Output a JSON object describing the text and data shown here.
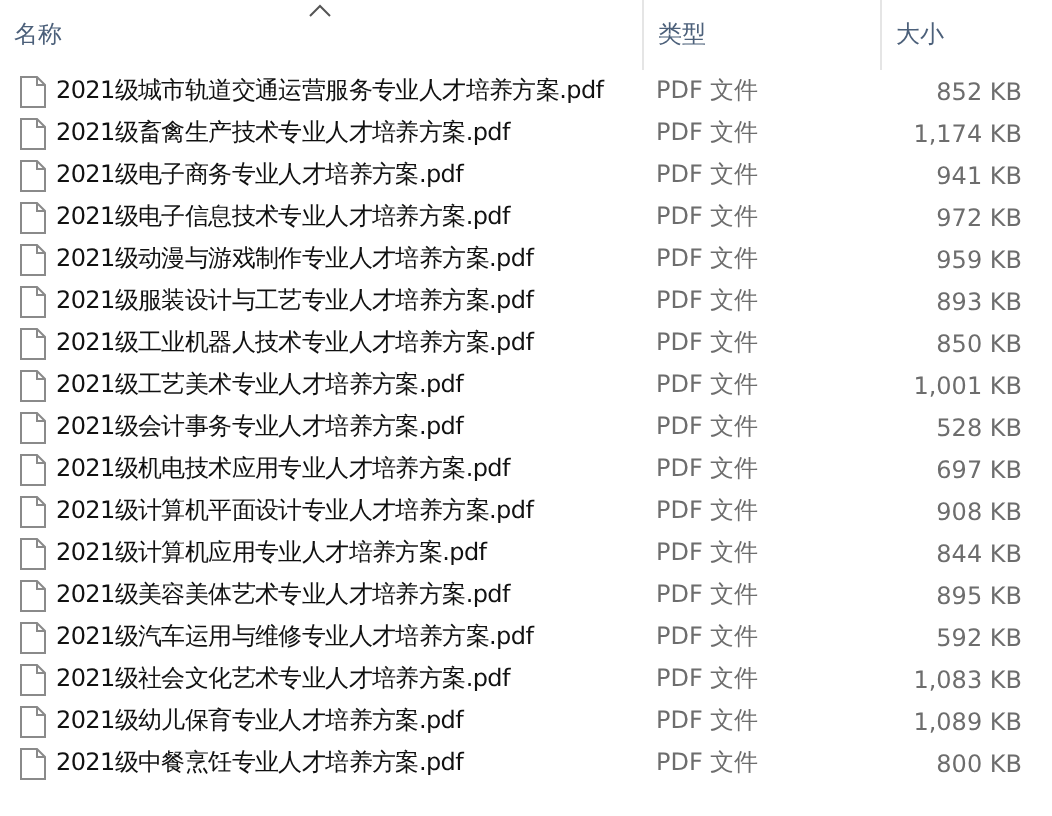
{
  "table": {
    "columns": [
      {
        "label": "名称",
        "sorted": true
      },
      {
        "label": "类型",
        "sorted": false
      },
      {
        "label": "大小",
        "sorted": false
      }
    ],
    "rows": [
      {
        "name": "2021级城市轨道交通运营服务专业人才培养方案.pdf",
        "type": "PDF 文件",
        "size": "852 KB"
      },
      {
        "name": "2021级畜禽生产技术专业人才培养方案.pdf",
        "type": "PDF 文件",
        "size": "1,174 KB"
      },
      {
        "name": "2021级电子商务专业人才培养方案.pdf",
        "type": "PDF 文件",
        "size": "941 KB"
      },
      {
        "name": "2021级电子信息技术专业人才培养方案.pdf",
        "type": "PDF 文件",
        "size": "972 KB"
      },
      {
        "name": "2021级动漫与游戏制作专业人才培养方案.pdf",
        "type": "PDF 文件",
        "size": "959 KB"
      },
      {
        "name": "2021级服装设计与工艺专业人才培养方案.pdf",
        "type": "PDF 文件",
        "size": "893 KB"
      },
      {
        "name": "2021级工业机器人技术专业人才培养方案.pdf",
        "type": "PDF 文件",
        "size": "850 KB"
      },
      {
        "name": "2021级工艺美术专业人才培养方案.pdf",
        "type": "PDF 文件",
        "size": "1,001 KB"
      },
      {
        "name": "2021级会计事务专业人才培养方案.pdf",
        "type": "PDF 文件",
        "size": "528 KB"
      },
      {
        "name": "2021级机电技术应用专业人才培养方案.pdf",
        "type": "PDF 文件",
        "size": "697 KB"
      },
      {
        "name": "2021级计算机平面设计专业人才培养方案.pdf",
        "type": "PDF 文件",
        "size": "908 KB"
      },
      {
        "name": "2021级计算机应用专业人才培养方案.pdf",
        "type": "PDF 文件",
        "size": "844 KB"
      },
      {
        "name": "2021级美容美体艺术专业人才培养方案.pdf",
        "type": "PDF 文件",
        "size": "895 KB"
      },
      {
        "name": "2021级汽车运用与维修专业人才培养方案.pdf",
        "type": "PDF 文件",
        "size": "592 KB"
      },
      {
        "name": "2021级社会文化艺术专业人才培养方案.pdf",
        "type": "PDF 文件",
        "size": "1,083 KB"
      },
      {
        "name": "2021级幼儿保育专业人才培养方案.pdf",
        "type": "PDF 文件",
        "size": "1,089 KB"
      },
      {
        "name": "2021级中餐烹饪专业人才培养方案.pdf",
        "type": "PDF 文件",
        "size": "800 KB"
      }
    ]
  }
}
